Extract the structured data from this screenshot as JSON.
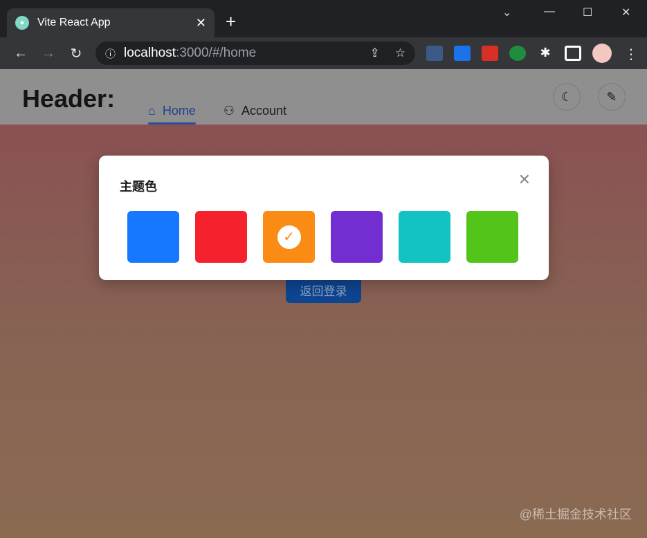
{
  "browser": {
    "tab_title": "Vite React App",
    "url_host": "localhost",
    "url_rest": ":3000/#/home"
  },
  "header": {
    "title": "Header:",
    "menu": [
      {
        "label": "Home",
        "icon": "home-icon",
        "active": true
      },
      {
        "label": "Account",
        "icon": "user-icon",
        "active": false
      }
    ]
  },
  "main": {
    "back_button": "返回登录"
  },
  "modal": {
    "title": "主题色",
    "selected_index": 2,
    "colors": [
      "#1677ff",
      "#f5222d",
      "#fa8c16",
      "#722ed1",
      "#13c2c2",
      "#52c41a"
    ]
  },
  "watermark": "@稀土掘金技术社区"
}
